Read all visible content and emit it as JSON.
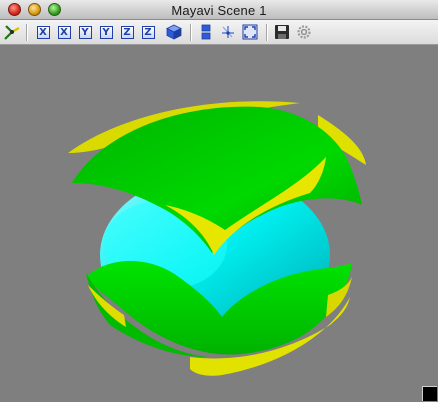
{
  "window": {
    "title": "Mayavi Scene 1"
  },
  "toolbar": {
    "pipeline_icon": "mayavi-pipeline-icon",
    "view_buttons": [
      {
        "name": "view-x-plus-button",
        "label": "X"
      },
      {
        "name": "view-x-minus-button",
        "label": "X"
      },
      {
        "name": "view-y-plus-button",
        "label": "Y"
      },
      {
        "name": "view-y-minus-button",
        "label": "Y"
      },
      {
        "name": "view-z-plus-button",
        "label": "Z"
      },
      {
        "name": "view-z-minus-button",
        "label": "Z"
      }
    ],
    "isometric_icon": "isometric-cube-icon",
    "parallel_projection_icon": "parallel-projection-icon",
    "axes_icon": "axes-icon",
    "full_screen_icon": "full-screen-icon",
    "save_icon": "save-icon",
    "configure_icon": "gear-icon"
  },
  "scene": {
    "background_color": "#7f7f7f",
    "surfaces": [
      {
        "name": "isosurface-yellow",
        "color": "#e6e600"
      },
      {
        "name": "isosurface-green",
        "color": "#00dd00"
      },
      {
        "name": "isosurface-cyan",
        "color": "#00f0f0"
      }
    ]
  }
}
